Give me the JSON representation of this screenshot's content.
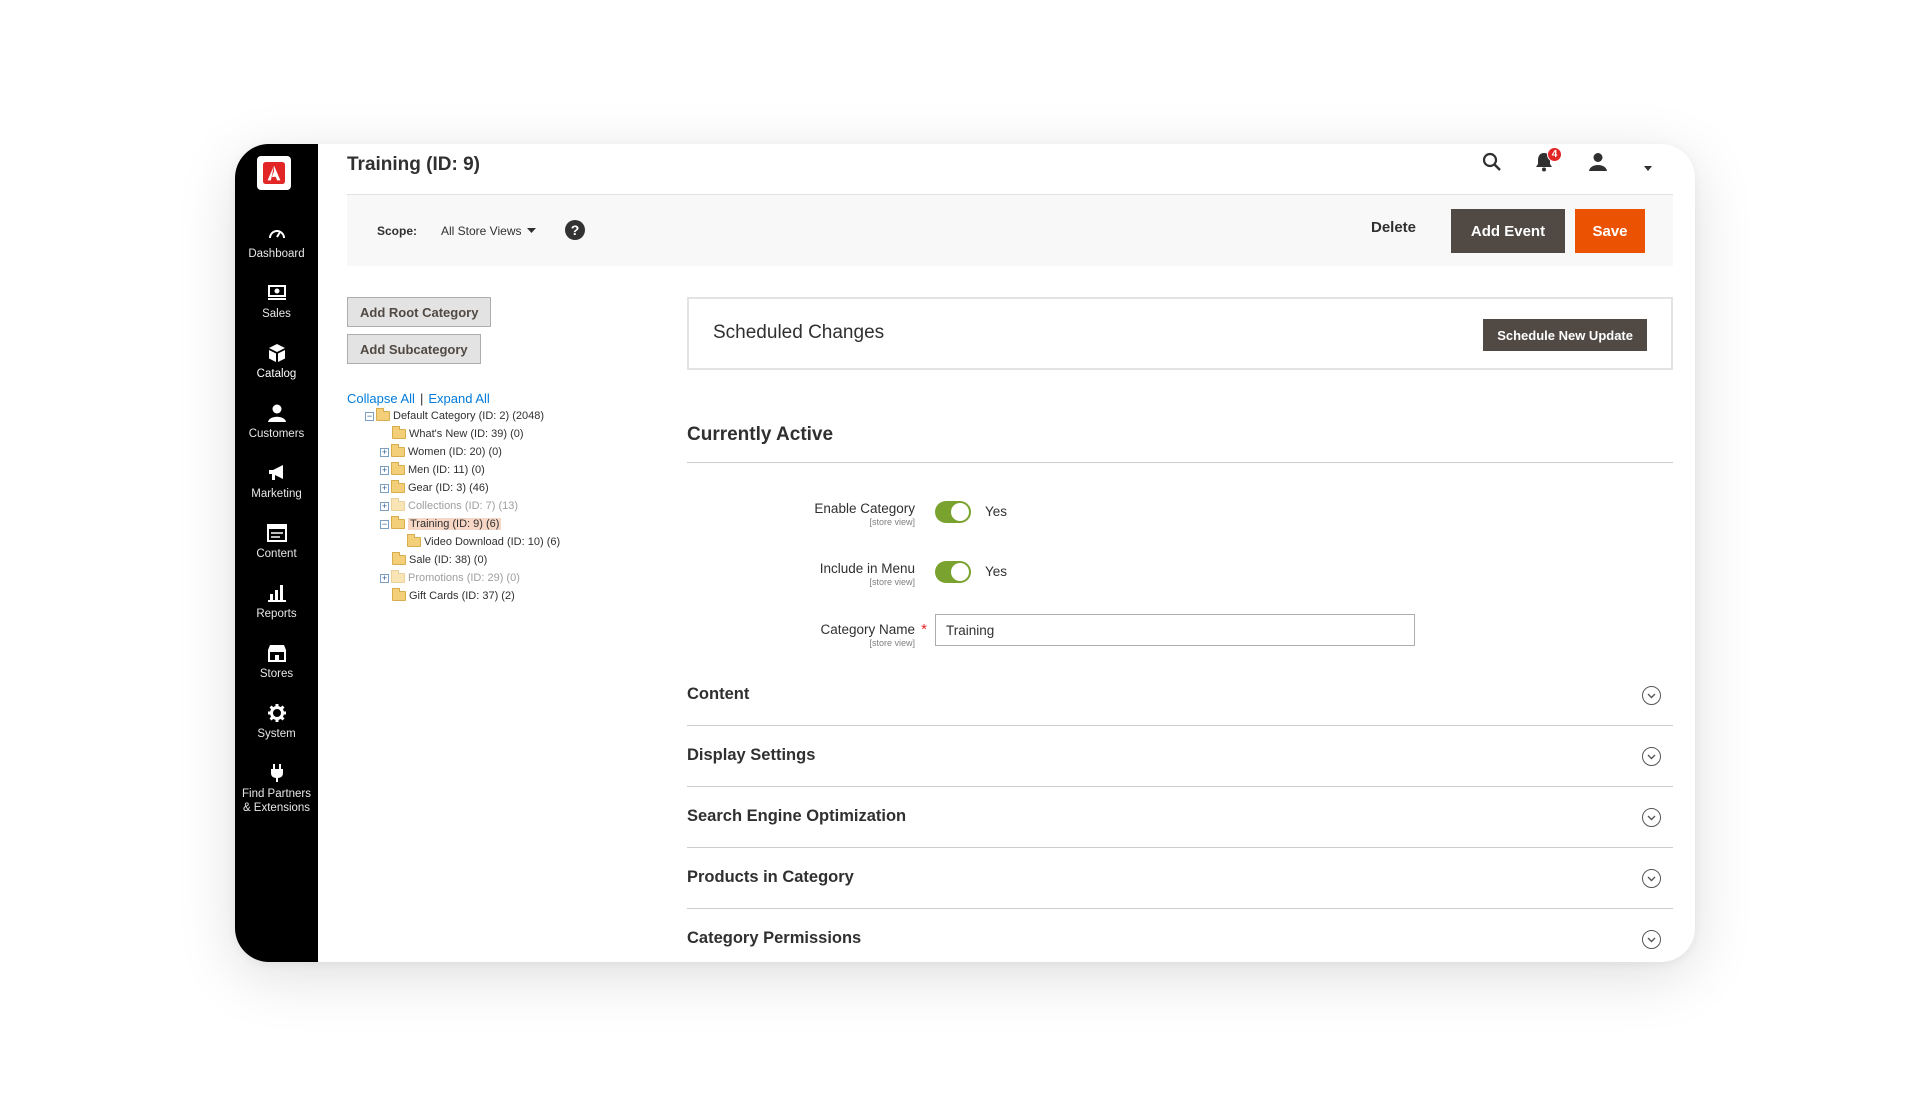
{
  "page_title": "Training (ID: 9)",
  "header": {
    "notification_count": "4"
  },
  "sidebar": {
    "items": [
      {
        "label": "Dashboard",
        "icon": "dashboard-icon"
      },
      {
        "label": "Sales",
        "icon": "sales-icon"
      },
      {
        "label": "Catalog",
        "icon": "catalog-icon"
      },
      {
        "label": "Customers",
        "icon": "customers-icon"
      },
      {
        "label": "Marketing",
        "icon": "marketing-icon"
      },
      {
        "label": "Content",
        "icon": "content-icon"
      },
      {
        "label": "Reports",
        "icon": "reports-icon"
      },
      {
        "label": "Stores",
        "icon": "stores-icon"
      },
      {
        "label": "System",
        "icon": "system-icon"
      },
      {
        "label": "Find Partners\n& Extensions",
        "icon": "extensions-icon"
      }
    ]
  },
  "action_bar": {
    "scope_label": "Scope:",
    "scope_value": "All Store Views",
    "help": "?",
    "delete_label": "Delete",
    "add_event_label": "Add Event",
    "save_label": "Save"
  },
  "tree_panel": {
    "add_root_label": "Add Root Category",
    "add_sub_label": "Add Subcategory",
    "collapse_all": "Collapse All",
    "separator": "|",
    "expand_all": "Expand All",
    "nodes": [
      {
        "label": "Default Category (ID: 2) (2048)",
        "toggle": "−"
      },
      {
        "label": "What's New (ID: 39) (0)",
        "toggle": ""
      },
      {
        "label": "Women (ID: 20) (0)",
        "toggle": "+"
      },
      {
        "label": "Men (ID: 11) (0)",
        "toggle": "+"
      },
      {
        "label": "Gear (ID: 3) (46)",
        "toggle": "+"
      },
      {
        "label": "Collections (ID: 7) (13)",
        "toggle": "+"
      },
      {
        "label": "Training (ID: 9) (6)",
        "toggle": "−"
      },
      {
        "label": "Video Download (ID: 10) (6)",
        "toggle": ""
      },
      {
        "label": "Sale (ID: 38) (0)",
        "toggle": ""
      },
      {
        "label": "Promotions (ID: 29) (0)",
        "toggle": "+"
      },
      {
        "label": "Gift Cards (ID: 37) (2)",
        "toggle": ""
      }
    ]
  },
  "scheduled_changes": {
    "title": "Scheduled Changes",
    "button_label": "Schedule New Update"
  },
  "currently_active": {
    "title": "Currently Active",
    "enable_category": {
      "label": "Enable Category",
      "scope": "[store view]",
      "value": "Yes"
    },
    "include_in_menu": {
      "label": "Include in Menu",
      "scope": "[store view]",
      "value": "Yes"
    },
    "category_name": {
      "label": "Category Name",
      "scope": "[store view]",
      "required": "*",
      "value": "Training"
    }
  },
  "sections": [
    {
      "title": "Content"
    },
    {
      "title": "Display Settings"
    },
    {
      "title": "Search Engine Optimization"
    },
    {
      "title": "Products in Category"
    },
    {
      "title": "Category Permissions"
    }
  ],
  "colors": {
    "sidebar_bg": "#000000",
    "brand_red": "#e22626",
    "save_orange": "#eb5202",
    "dark_button": "#514943",
    "toggle_green": "#79a22e",
    "link_blue": "#007bdb",
    "selected_node_bg": "#f6d7c6"
  }
}
